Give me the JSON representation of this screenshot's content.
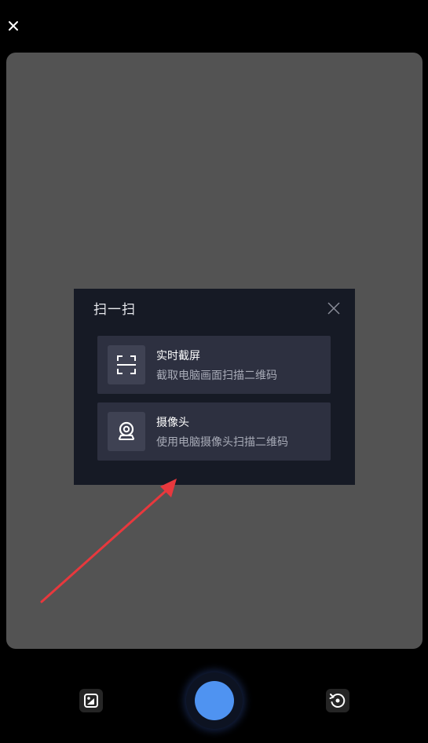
{
  "dialog": {
    "title": "扫一扫",
    "options": [
      {
        "title": "实时截屏",
        "desc": "截取电脑画面扫描二维码",
        "icon": "screenshot-frame-icon"
      },
      {
        "title": "摄像头",
        "desc": "使用电脑摄像头扫描二维码",
        "icon": "webcam-icon"
      }
    ]
  },
  "colors": {
    "background": "#000000",
    "preview": "#535353",
    "dialog": "#161a25",
    "option": "#2d3040",
    "shutter": "#4f93f1",
    "arrow": "#e8383d"
  },
  "icons": {
    "top_close": "close-icon",
    "dialog_close": "close-icon",
    "gallery": "gallery-image-icon",
    "rotate": "rotate-camera-icon"
  }
}
